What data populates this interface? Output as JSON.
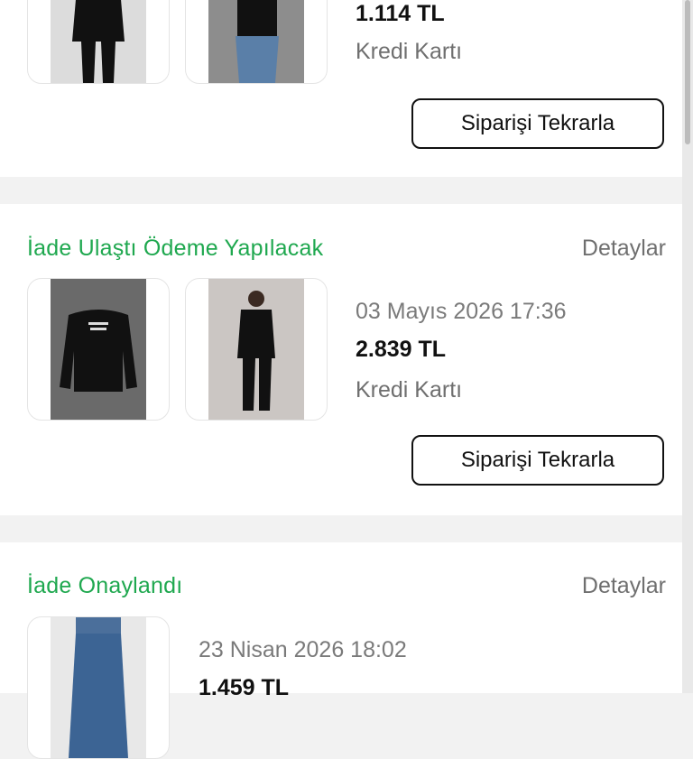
{
  "colors": {
    "status_green": "#1fa84f",
    "muted_text": "#6f6f6f",
    "background": "#f2f2f2",
    "card": "#ffffff"
  },
  "orders": [
    {
      "status": "",
      "details_label": "",
      "date": "",
      "amount": "1.114 TL",
      "payment": "Kredi Kartı",
      "reorder_label": "Siparişi Tekrarla",
      "products": [
        {
          "image": "woman-black-sweater"
        },
        {
          "image": "black-top-blue-jeans"
        }
      ]
    },
    {
      "status": "İade Ulaştı Ödeme Yapılacak",
      "details_label": "Detaylar",
      "date": "03 Mayıs 2026 17:36",
      "amount": "2.839 TL",
      "payment": "Kredi Kartı",
      "reorder_label": "Siparişi Tekrarla",
      "products": [
        {
          "image": "black-logo-sweatshirt"
        },
        {
          "image": "man-black-puffer-jacket"
        }
      ]
    },
    {
      "status": "İade Onaylandı",
      "details_label": "Detaylar",
      "date": "23 Nisan 2026 18:02",
      "amount": "1.459 TL",
      "payment": "",
      "reorder_label": "",
      "products": [
        {
          "image": "wide-leg-blue-jeans"
        }
      ]
    }
  ]
}
